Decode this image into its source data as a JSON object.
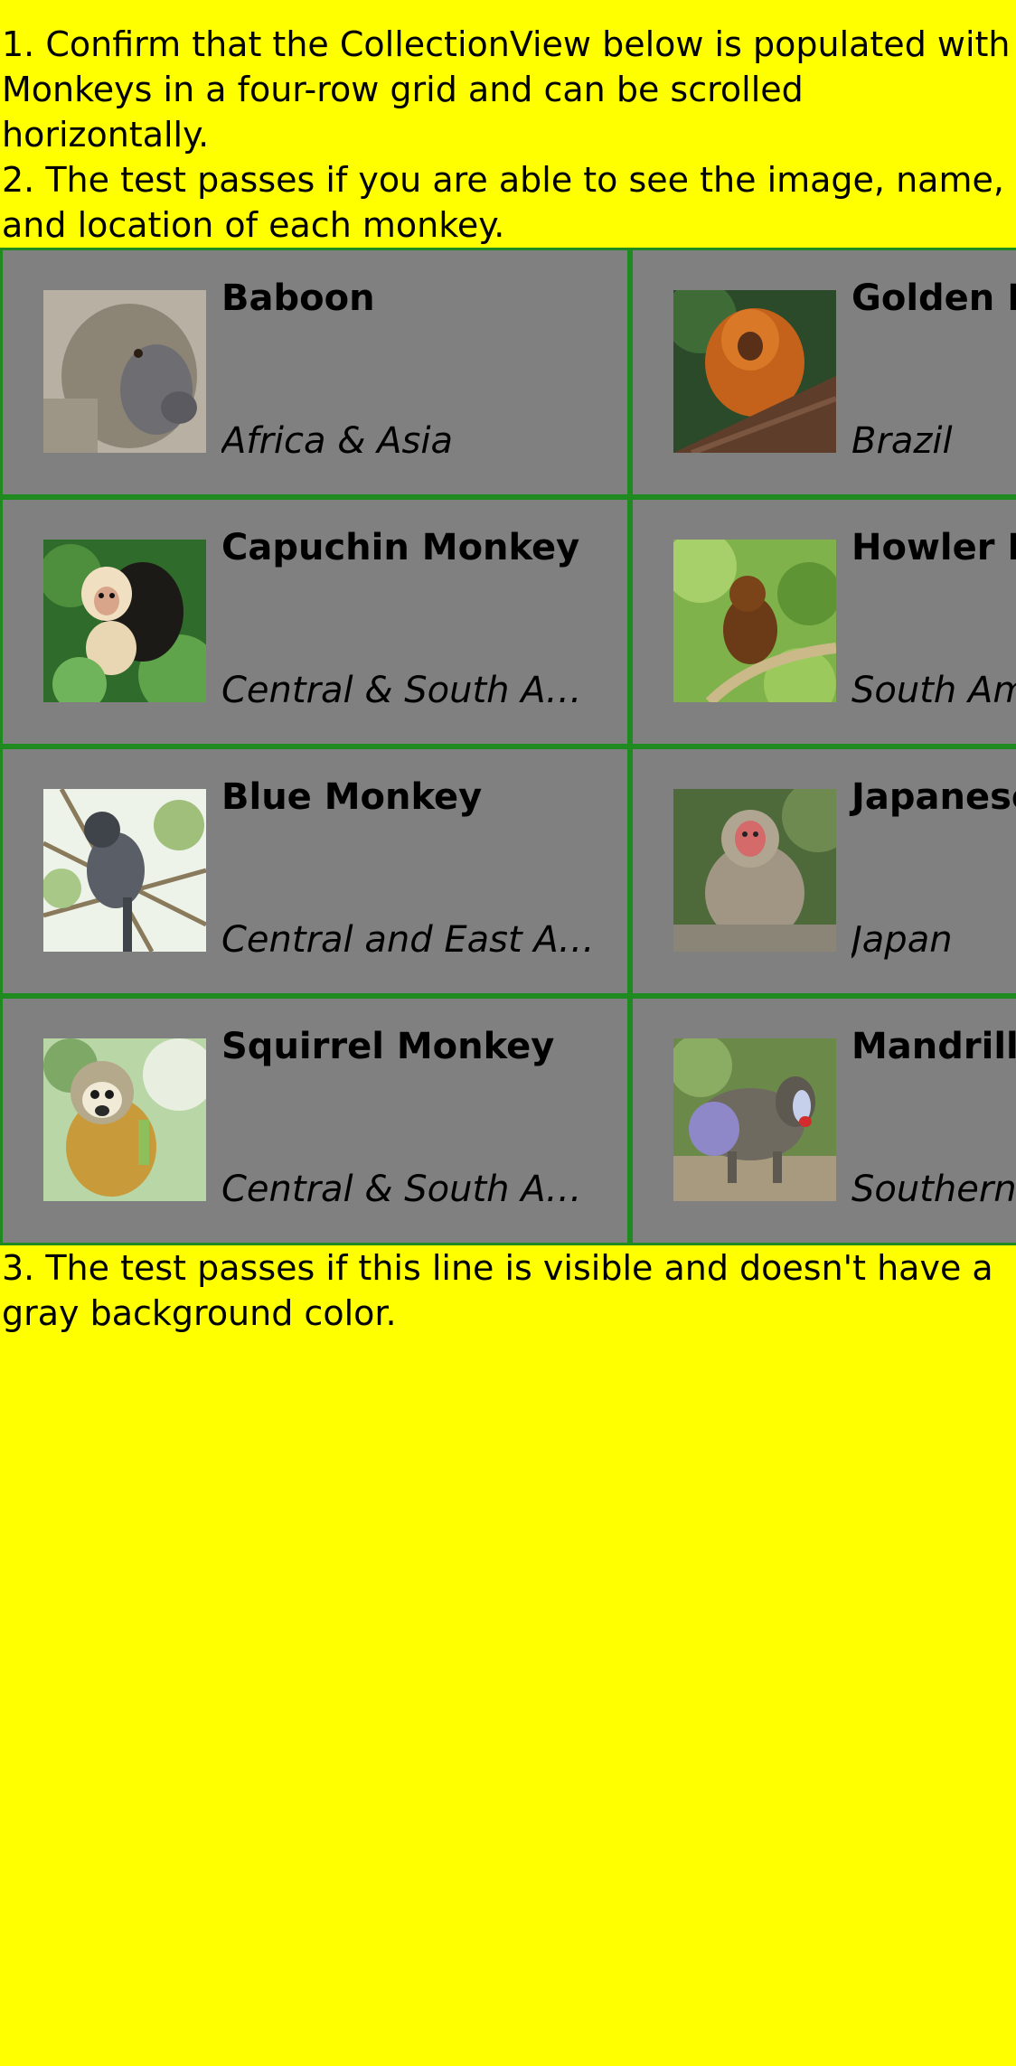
{
  "instructions": {
    "step1": "1. Confirm that the CollectionView below is populated with Monkeys in a four-row grid and can be scrolled horizontally.",
    "step2": "2. The test passes if you are able to see the image, name, and location of each monkey.",
    "step3": "3. The test passes if this line is visible and doesn't have a gray background color."
  },
  "colors": {
    "page_background": "#ffff00",
    "cell_background": "#808080",
    "cell_border": "#1f8a1f"
  },
  "monkeys": [
    {
      "name": "Baboon",
      "location": "Africa & Asia",
      "icon": "baboon-photo"
    },
    {
      "name": "Capuchin Monkey",
      "location": "Central & South America",
      "icon": "capuchin-monkey-photo"
    },
    {
      "name": "Blue Monkey",
      "location": "Central and East Africa",
      "icon": "blue-monkey-photo"
    },
    {
      "name": "Squirrel Monkey",
      "location": "Central & South America",
      "icon": "squirrel-monkey-photo"
    },
    {
      "name": "Golden Lion Tamarin",
      "location": "Brazil",
      "icon": "golden-lion-tamarin-photo"
    },
    {
      "name": "Howler Monkey",
      "location": "South America",
      "icon": "howler-monkey-photo"
    },
    {
      "name": "Japanese Macaque",
      "location": "Japan",
      "icon": "japanese-macaque-photo"
    },
    {
      "name": "Mandrill",
      "location": "Southern Cameroon, Gabon, and Congo",
      "icon": "mandrill-photo"
    }
  ]
}
